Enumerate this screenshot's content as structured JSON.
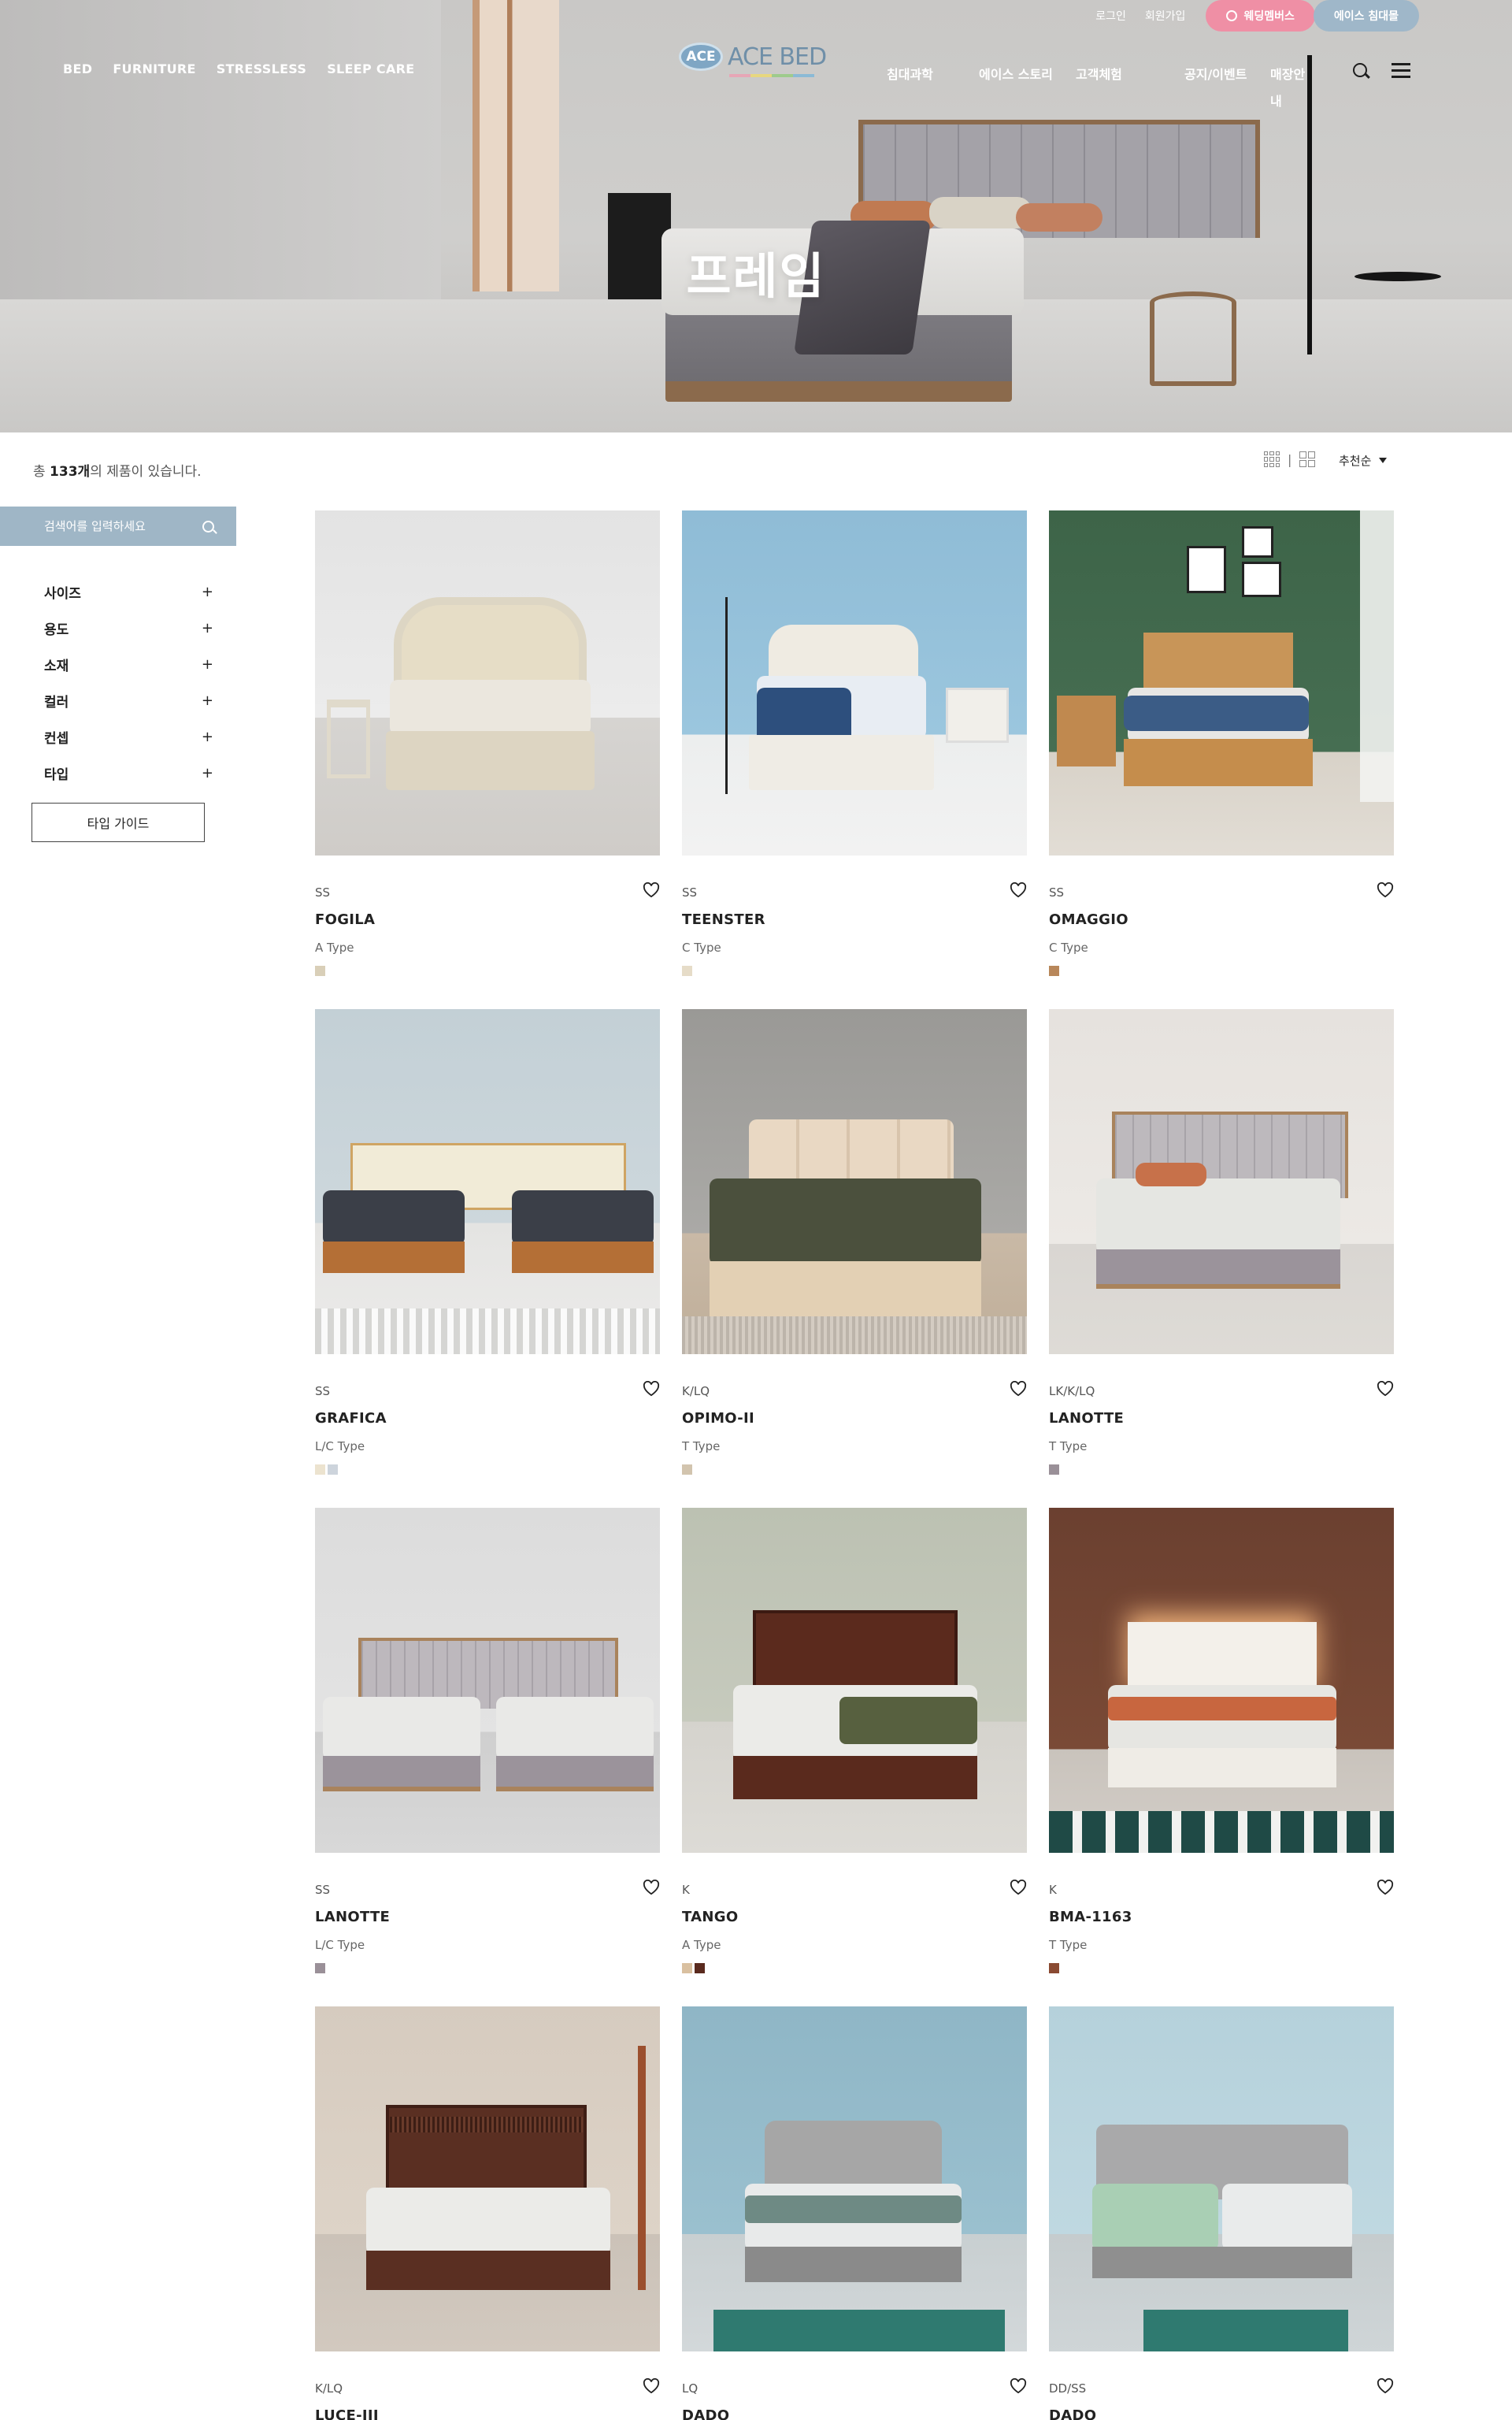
{
  "hero": {
    "title": "프레임"
  },
  "util": {
    "login": "로그인",
    "signup": "회원가입",
    "wedding": "웨딩멤버스",
    "ace_bed": "에이스 침대몰"
  },
  "nav_left": [
    "BED",
    "FURNITURE",
    "STRESSLESS",
    "SLEEP CARE"
  ],
  "logo": {
    "mark": "ACE",
    "word": "ACE BED"
  },
  "nav_right": [
    "침대과학",
    "에이스 스토리",
    "고객체험",
    "공지/이벤트",
    "매장안내"
  ],
  "toolbar": {
    "count_prefix": "총 ",
    "count_value": "133개",
    "count_suffix": "의 제품이 있습니다.",
    "view_sep": "|",
    "sort_label": "추천순"
  },
  "sidebar": {
    "search_placeholder": "검색어를 입력하세요",
    "filters": [
      "사이즈",
      "용도",
      "소재",
      "컬러",
      "컨셉",
      "타입"
    ],
    "plus": "+",
    "type_guide": "타입 가이드"
  },
  "products": [
    {
      "size": "SS",
      "name": "FOGILA",
      "type": "A Type",
      "swatches": [
        "#d9cfb8"
      ]
    },
    {
      "size": "SS",
      "name": "TEENSTER",
      "type": "C Type",
      "swatches": [
        "#e6dcc8"
      ]
    },
    {
      "size": "SS",
      "name": "OMAGGIO",
      "type": "C Type",
      "swatches": [
        "#b8875a"
      ]
    },
    {
      "size": "SS",
      "name": "GRAFICA",
      "type": "L/C Type",
      "swatches": [
        "#ece3cf",
        "#cdd4dc"
      ]
    },
    {
      "size": "K/LQ",
      "name": "OPIMO-II",
      "type": "T Type",
      "swatches": [
        "#d2c4ae"
      ]
    },
    {
      "size": "LK/K/LQ",
      "name": "LANOTTE",
      "type": "T Type",
      "swatches": [
        "#9a9098"
      ]
    },
    {
      "size": "SS",
      "name": "LANOTTE",
      "type": "L/C Type",
      "swatches": [
        "#9a9098"
      ]
    },
    {
      "size": "K",
      "name": "TANGO",
      "type": "A Type",
      "swatches": [
        "#d9c0a0",
        "#5a2a1e"
      ]
    },
    {
      "size": "K",
      "name": "BMA-1163",
      "type": "T Type",
      "swatches": [
        "#8a4a32"
      ]
    },
    {
      "size": "K/LQ",
      "name": "LUCE-III",
      "type": "",
      "swatches": []
    },
    {
      "size": "LQ",
      "name": "DADO",
      "type": "",
      "swatches": []
    },
    {
      "size": "DD/SS",
      "name": "DADO",
      "type": "",
      "swatches": []
    }
  ]
}
